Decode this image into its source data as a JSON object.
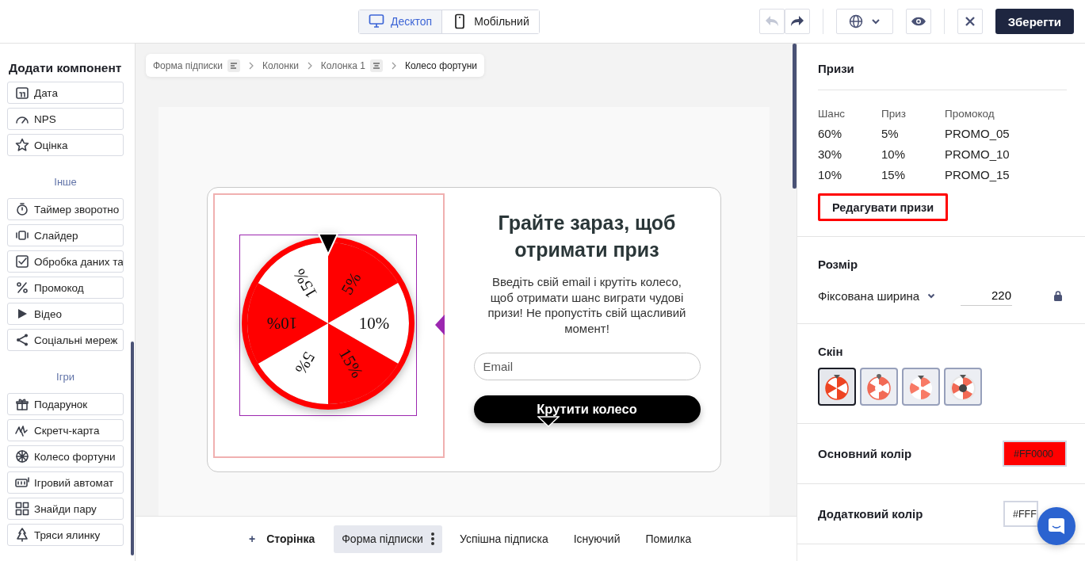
{
  "toolbar": {
    "devices": [
      {
        "label": "Десктоп",
        "kind": "desktop",
        "selected": true
      },
      {
        "label": "Мобільний",
        "kind": "mobile",
        "selected": false
      }
    ],
    "undo": {
      "disabled": true
    },
    "redo": {
      "disabled": false
    },
    "save": "Зберегти"
  },
  "sidebar": {
    "title": "Додати компонент",
    "groups": [
      {
        "items": [
          {
            "label": "Дата",
            "kind": "calendar"
          },
          {
            "label": "NPS",
            "kind": "gauge"
          },
          {
            "label": "Оцінка",
            "kind": "star"
          }
        ]
      },
      {
        "heading": "Інше",
        "items": [
          {
            "label": "Таймер зворотно",
            "kind": "timer"
          },
          {
            "label": "Слайдер",
            "kind": "slider"
          },
          {
            "label": "Обробка даних та",
            "kind": "checkbox"
          },
          {
            "label": "Промокод",
            "kind": "percent"
          },
          {
            "label": "Відео",
            "kind": "play"
          },
          {
            "label": "Соціальні мереж",
            "kind": "share"
          }
        ]
      },
      {
        "heading": "Ігри",
        "items": [
          {
            "label": "Подарунок",
            "kind": "gift"
          },
          {
            "label": "Скретч-карта",
            "kind": "scratch"
          },
          {
            "label": "Колесо фортуни",
            "kind": "wheel"
          },
          {
            "label": "Ігровий автомат",
            "kind": "slot"
          },
          {
            "label": "Знайди пару",
            "kind": "cards"
          },
          {
            "label": "Тряси ялинку",
            "kind": "tree"
          }
        ]
      }
    ]
  },
  "breadcrumb": [
    {
      "label": "Форма підписки",
      "kind": "align-left"
    },
    {
      "label": "Колонки",
      "kind": "plain"
    },
    {
      "label": "Колонка 1",
      "kind": "align-center"
    },
    {
      "label": "Колесо фортуни",
      "kind": "current"
    }
  ],
  "wheel": {
    "segments": [
      {
        "label": "5%",
        "color": "#ff0000"
      },
      {
        "label": "10%",
        "color": "#ffffff"
      },
      {
        "label": "15%",
        "color": "#ff0000"
      },
      {
        "label": "5%",
        "color": "#ffffff"
      },
      {
        "label": "10%",
        "color": "#ff0000"
      },
      {
        "label": "15%",
        "color": "#ffffff"
      }
    ]
  },
  "promo": {
    "title": "Грайте зараз, щоб отримати приз",
    "text": "Введіть свій email і крутіть колесо, щоб отримати шанс виграти чудові призи! Не пропустіть свій щасливий момент!",
    "email": {
      "placeholder": "Email"
    },
    "button": "Крутити колесо"
  },
  "page_tabs": {
    "add": {
      "icon": "+",
      "label": "Сторінка"
    },
    "tabs": [
      {
        "label": "Форма підписки",
        "selected": true
      },
      {
        "label": "Успішна підписка",
        "selected": false
      },
      {
        "label": "Існуючий",
        "selected": false
      },
      {
        "label": "Помилка",
        "selected": false
      }
    ]
  },
  "panel": {
    "prizes": {
      "title": "Призи",
      "columns": [
        "Шанс",
        "Приз",
        "Промокод"
      ],
      "rows": [
        [
          "60%",
          "5%",
          "PROMO_05"
        ],
        [
          "30%",
          "10%",
          "PROMO_10"
        ],
        [
          "10%",
          "15%",
          "PROMO_15"
        ]
      ],
      "edit_button": "Редагувати призи"
    },
    "size": {
      "title": "Розмір",
      "mode": "Фіксована ширина",
      "value": "220"
    },
    "skin": {
      "title": "Скін",
      "options": [
        {
          "kind": "classic",
          "selected": true
        },
        {
          "kind": "pin",
          "selected": false
        },
        {
          "kind": "flat",
          "selected": false
        },
        {
          "kind": "ring",
          "selected": false
        }
      ]
    },
    "colors": [
      {
        "label": "Основний колір",
        "value": "#FF0000",
        "color": "#ff0000"
      },
      {
        "label": "Додатковий колір",
        "value": "#FFF",
        "color": "#ffffff"
      }
    ]
  }
}
